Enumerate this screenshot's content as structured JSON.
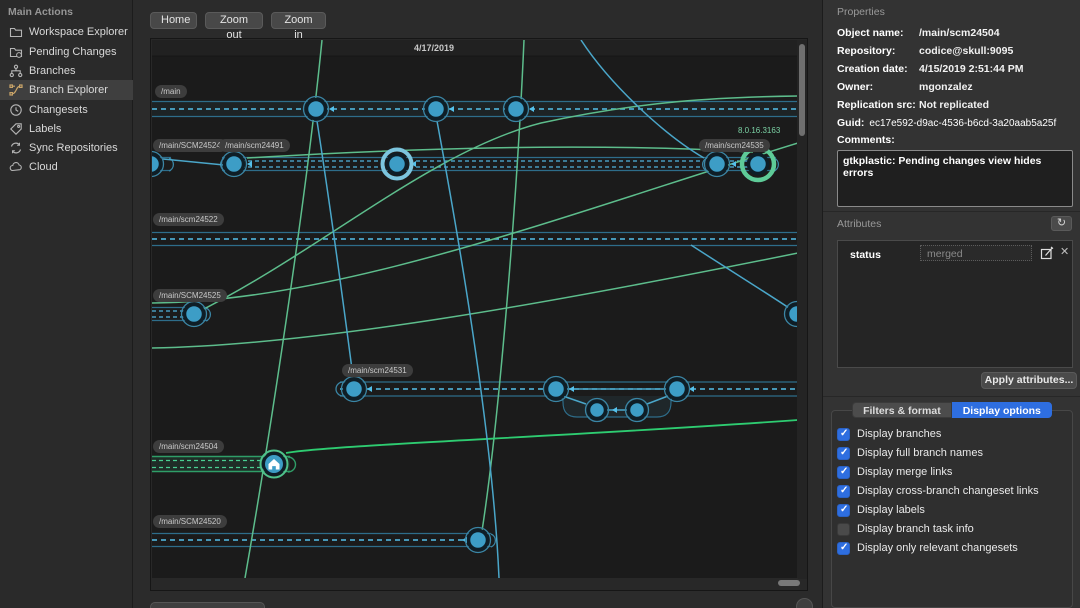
{
  "sidebar": {
    "header": "Main Actions",
    "items": [
      {
        "label": "Workspace Explorer",
        "icon": "workspace-explorer-icon",
        "selected": false
      },
      {
        "label": "Pending Changes",
        "icon": "pending-changes-icon",
        "selected": false
      },
      {
        "label": "Branches",
        "icon": "branches-icon",
        "selected": false
      },
      {
        "label": "Branch Explorer",
        "icon": "branch-explorer-icon",
        "selected": true
      },
      {
        "label": "Changesets",
        "icon": "changesets-icon",
        "selected": false
      },
      {
        "label": "Labels",
        "icon": "labels-icon",
        "selected": false
      },
      {
        "label": "Sync Repositories",
        "icon": "sync-repositories-icon",
        "selected": false
      },
      {
        "label": "Cloud",
        "icon": "cloud-icon",
        "selected": false
      }
    ]
  },
  "toolbar": {
    "home": "Home",
    "zoom_out": "Zoom out",
    "zoom_in": "Zoom in"
  },
  "canvas": {
    "date_header": "4/17/2019",
    "version_label": "8.0.16.3163",
    "branch_labels": [
      {
        "label": "/main"
      },
      {
        "label": "/main/SCM24524"
      },
      {
        "label": "/main/scm24491"
      },
      {
        "label": "/main/scm24535"
      },
      {
        "label": "/main/scm24522"
      },
      {
        "label": "/main/SCM24525"
      },
      {
        "label": "/main/scm24531"
      },
      {
        "label": "/main/scm24504"
      },
      {
        "label": "/main/SCM24520"
      }
    ]
  },
  "properties": {
    "title": "Properties",
    "fields": [
      {
        "label": "Object name:",
        "value": "/main/scm24504"
      },
      {
        "label": "Repository:",
        "value": "codice@skull:9095"
      },
      {
        "label": "Creation date:",
        "value": "4/15/2019 2:51:44 PM"
      },
      {
        "label": "Owner:",
        "value": "mgonzalez"
      },
      {
        "label": "Replication src:",
        "value": "Not replicated"
      }
    ],
    "guid_label": "Guid:",
    "guid_value": "ec17e592-d9ac-4536-b6cd-3a20aab5a25f",
    "comments_label": "Comments:",
    "comments": "gtkplastic: Pending changes view hides errors"
  },
  "attributes": {
    "title": "Attributes",
    "refresh_icon": "refresh-icon",
    "rows": [
      {
        "name": "status",
        "value": "merged"
      }
    ],
    "apply_button": "Apply attributes..."
  },
  "tabs": [
    {
      "label": "Filters & format",
      "selected": false
    },
    {
      "label": "Display options",
      "selected": true
    }
  ],
  "display_options": [
    {
      "label": "Display branches",
      "checked": true
    },
    {
      "label": "Display full branch names",
      "checked": true
    },
    {
      "label": "Display merge links",
      "checked": true
    },
    {
      "label": "Display cross-branch changeset links",
      "checked": true
    },
    {
      "label": "Display labels",
      "checked": true
    },
    {
      "label": "Display branch task info",
      "checked": false
    },
    {
      "label": "Display only relevant changesets",
      "checked": true
    }
  ],
  "colors": {
    "accent_blue": "#2e6ee0",
    "node_blue": "#3d9dc6",
    "line_blue": "#4aa6c9",
    "dash_blue": "#55c0ea",
    "line_green": "#5dbd8c",
    "selected_branch_green": "#2f9e68",
    "selected_ring_green": "#5ecb98"
  }
}
